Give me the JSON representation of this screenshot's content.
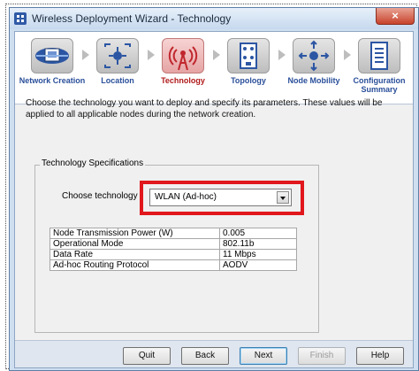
{
  "window": {
    "title": "Wireless Deployment Wizard - Technology",
    "close_glyph": "×"
  },
  "steps": [
    {
      "label": "Network Creation",
      "icon": "network-creation-icon"
    },
    {
      "label": "Location",
      "icon": "location-icon"
    },
    {
      "label": "Technology",
      "icon": "technology-antenna-icon",
      "active": true
    },
    {
      "label": "Topology",
      "icon": "topology-icon"
    },
    {
      "label": "Node Mobility",
      "icon": "node-mobility-icon"
    },
    {
      "label": "Configuration Summary",
      "icon": "configuration-summary-icon"
    }
  ],
  "intro": "Choose the technology you want to deploy and specify its parameters. These values will be applied to all applicable nodes during the network creation.",
  "group": {
    "legend": "Technology Specifications",
    "choose_label": "Choose technology",
    "selected": "WLAN (Ad-hoc)"
  },
  "params": [
    {
      "key": "Node Transmission Power (W)",
      "value": "0.005"
    },
    {
      "key": "Operational Mode",
      "value": "802.11b"
    },
    {
      "key": "Data Rate",
      "value": "11 Mbps"
    },
    {
      "key": "Ad-hoc Routing Protocol",
      "value": "AODV"
    }
  ],
  "buttons": {
    "quit": "Quit",
    "back": "Back",
    "next": "Next",
    "finish": "Finish",
    "help": "Help"
  },
  "colors": {
    "highlight": "#e0171c",
    "step_label": "#2a4f9a",
    "active_step_label": "#b11a1a"
  }
}
